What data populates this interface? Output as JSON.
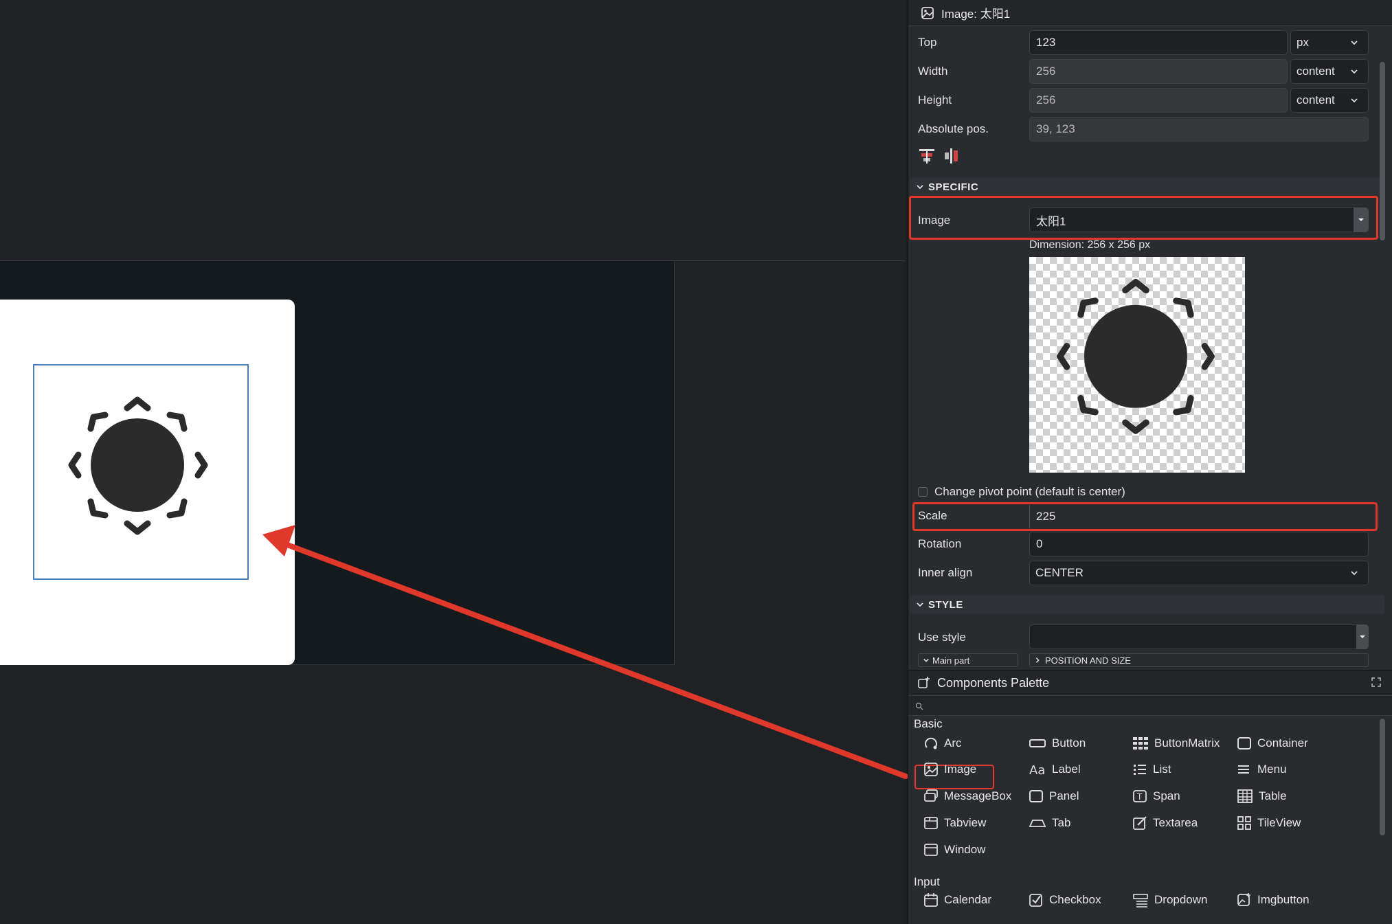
{
  "canvas": {
    "arrow_color": "#e0382a"
  },
  "properties": {
    "header_title": "Image: 太阳1",
    "rows": [
      {
        "label": "Top",
        "value": "123",
        "unit": "px"
      },
      {
        "label": "Width",
        "value": "256",
        "unit": "content"
      },
      {
        "label": "Height",
        "value": "256",
        "unit": "content"
      }
    ],
    "abs_pos_label": "Absolute pos.",
    "abs_pos_value": "39, 123",
    "specific_section": "SPECIFIC",
    "image_label": "Image",
    "image_value": "太阳1",
    "dimension_text": "Dimension: 256 x 256 px",
    "pivot_label": "Change pivot point (default is center)",
    "scale_label": "Scale",
    "scale_value": "225",
    "rotation_label": "Rotation",
    "rotation_value": "0",
    "inner_align_label": "Inner align",
    "inner_align_value": "CENTER",
    "style_section": "STYLE",
    "use_style_label": "Use style",
    "use_style_value": "",
    "main_part_label": "Main part",
    "position_size_label": "POSITION AND SIZE"
  },
  "palette": {
    "title": "Components Palette",
    "basic_group": "Basic",
    "basic_items": [
      "Arc",
      "Button",
      "ButtonMatrix",
      "Container",
      "Image",
      "Label",
      "List",
      "Menu",
      "MessageBox",
      "Panel",
      "Span",
      "Table",
      "Tabview",
      "Tab",
      "Textarea",
      "TileView",
      "Window"
    ],
    "input_group": "Input",
    "input_items": [
      "Calendar",
      "Checkbox",
      "Dropdown",
      "Imgbutton"
    ]
  },
  "colors": {
    "highlight": "#e0382a",
    "selection_border": "#4a7dc0",
    "panel_bg": "#2a2b2e",
    "canvas_bg": "#151a1f"
  }
}
